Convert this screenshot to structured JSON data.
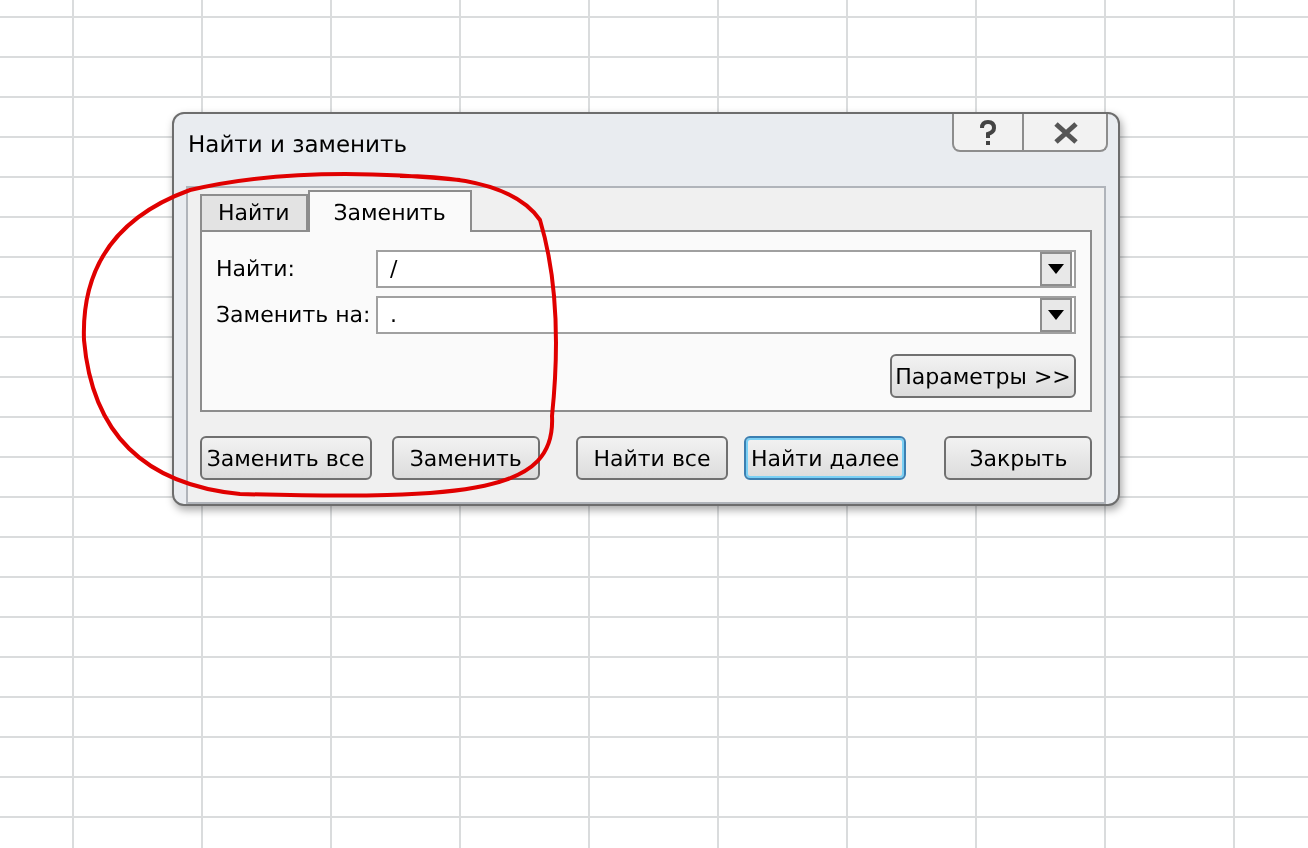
{
  "window": {
    "title": "Найти и заменить"
  },
  "tabs": [
    {
      "label": "Найти",
      "selected": false
    },
    {
      "label": "Заменить",
      "selected": true
    }
  ],
  "fields": [
    {
      "label": "Найти:",
      "value": "/"
    },
    {
      "label": "Заменить на:",
      "value": "."
    }
  ],
  "options_button": "Параметры >>",
  "buttons": [
    {
      "label": "Заменить все",
      "focused": false
    },
    {
      "label": "Заменить",
      "focused": false
    },
    {
      "label": "Найти все",
      "focused": false
    },
    {
      "label": "Найти далее",
      "focused": true
    },
    {
      "label": "Закрыть",
      "focused": false
    }
  ]
}
